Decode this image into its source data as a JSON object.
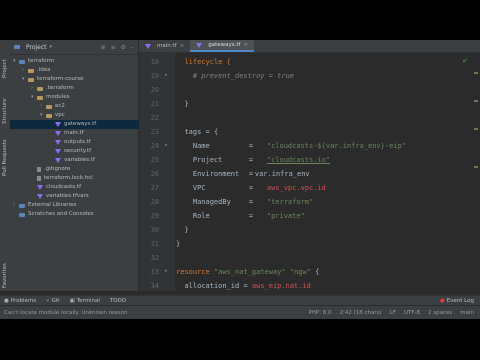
{
  "sidebar_tabs": [
    "Project",
    "Structure",
    "Pull Requests",
    "Favorites"
  ],
  "project": {
    "title": "Project",
    "items": [
      {
        "label": "terraform",
        "type": "folder"
      },
      {
        "label": ".idea",
        "type": "folder"
      },
      {
        "label": "terraform-course",
        "type": "folder"
      },
      {
        "label": ".terraform",
        "type": "folder"
      },
      {
        "label": "modules",
        "type": "folder"
      },
      {
        "label": "ec2",
        "type": "folder"
      },
      {
        "label": "vpc",
        "type": "folder"
      },
      {
        "label": "gateways.tf",
        "type": "tf"
      },
      {
        "label": "main.tf",
        "type": "tf"
      },
      {
        "label": "outputs.tf",
        "type": "tf"
      },
      {
        "label": "security.tf",
        "type": "tf"
      },
      {
        "label": "variables.tf",
        "type": "tf"
      },
      {
        "label": ".gitignore",
        "type": "file"
      },
      {
        "label": "terraform.lock.hcl",
        "type": "file"
      },
      {
        "label": "cloudcasts.tf",
        "type": "tf"
      },
      {
        "label": "variables.tfvars",
        "type": "tf"
      },
      {
        "label": "External Libraries",
        "type": "lib"
      },
      {
        "label": "Scratches and Consoles",
        "type": "lib"
      }
    ]
  },
  "tabs": [
    "main.tf",
    "gateways.tf"
  ],
  "code": {
    "line_numbers": [
      "18",
      "19",
      "20",
      "21",
      "22",
      "23",
      "24",
      "25",
      "26",
      "27",
      "28",
      "29",
      "30",
      "31",
      "32",
      "33",
      "34"
    ],
    "l18": "lifecycle {",
    "l19": "# prevent_destroy = true",
    "l20": "",
    "l21": "}",
    "l22": "",
    "l23a": "tags = {",
    "l24k": "Name",
    "l24v": "\"cloudcasts-${var.infra_env}-eip\"",
    "l25k": "Project",
    "l25v": "\"cloudcasts.io\"",
    "l26k": "Environment",
    "l26v": "var.infra_env",
    "l27k": "VPC",
    "l27v": "aws_vpc.vpc.id",
    "l28k": "ManagedBy",
    "l28v": "\"terraform\"",
    "l29k": "Role",
    "l29v": "\"private\"",
    "l30": "}",
    "l31": "}",
    "l32a": "resource",
    "l32b": "\"aws_nat_gateway\"",
    "l32c": "\"ngw\"",
    "l32d": "{",
    "l33k": "allocation_id",
    "l33v": "aws_eip.nat.id",
    "eq": "="
  },
  "bottom_tools": [
    "Problems",
    "Git",
    "Terminal",
    "TODO"
  ],
  "event_log": "Event Log",
  "status": {
    "message": "Can't locate module locally. Unknown reason",
    "items": [
      "PHP: 8.0",
      "2:42 (18 chars)",
      "LF",
      "UTF-8",
      "2 spaces",
      "main"
    ]
  }
}
